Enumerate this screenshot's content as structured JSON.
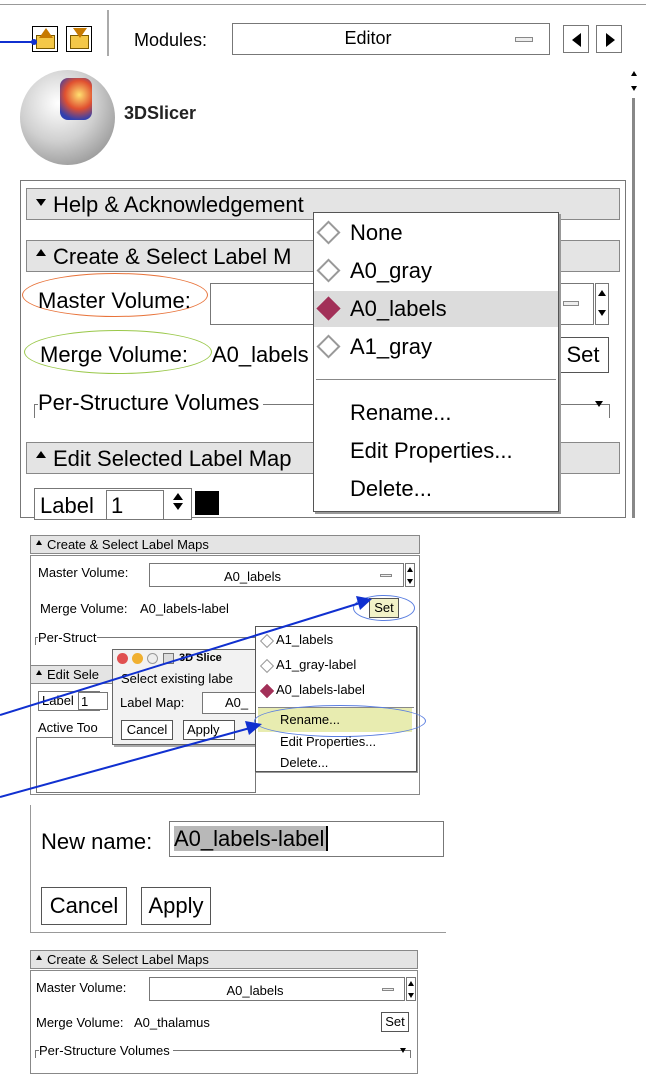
{
  "panel1": {
    "modules_label": "Modules:",
    "module_value": "Editor",
    "logo_text": "3DSlicer",
    "help_header": "Help & Acknowledgement",
    "create_header": "Create & Select Label M",
    "master_label": "Master Volume:",
    "merge_label": "Merge Volume:",
    "merge_value": "A0_labels",
    "set_label": "Set",
    "per_structure": "Per-Structure Volumes",
    "edit_header": "Edit Selected Label Map",
    "label_label": "Label",
    "label_value": "1",
    "menu": {
      "items": [
        "None",
        "A0_gray",
        "A0_labels",
        "A1_gray"
      ],
      "selected": "A0_labels",
      "actions": [
        "Rename...",
        "Edit Properties...",
        "Delete..."
      ]
    }
  },
  "panel2": {
    "create_header": "Create & Select Label Maps",
    "master_label": "Master Volume:",
    "master_value": "A0_labels",
    "merge_label": "Merge Volume:",
    "merge_value": "A0_labels-label",
    "set_label": "Set",
    "per_structure": "Per-Struct",
    "dialog_title": "3D Slice",
    "dialog_text": "Select existing labe",
    "labelmap_label": "Label Map:",
    "labelmap_value": "A0_",
    "cancel_label": "Cancel",
    "apply_label": "Apply",
    "edit_header": "Edit Sele",
    "label_label": "Label",
    "label_value": "1",
    "active_tools": "Active Too",
    "menu": {
      "items": [
        "A1_labels",
        "A1_gray-label",
        "A0_labels-label"
      ],
      "selected": "A0_labels-label",
      "actions": [
        "Rename...",
        "Edit Properties...",
        "Delete..."
      ]
    }
  },
  "panel3": {
    "new_name_label": "New name:",
    "new_name_value": "A0_labels-label",
    "cancel_label": "Cancel",
    "apply_label": "Apply"
  },
  "panel4": {
    "create_header": "Create & Select Label Maps",
    "master_label": "Master Volume:",
    "master_value": "A0_labels",
    "merge_label": "Merge Volume:",
    "merge_value": "A0_thalamus",
    "set_label": "Set",
    "per_structure": "Per-Structure Volumes"
  },
  "colors": {
    "highlight_orange": "#e8733a",
    "highlight_green": "#9ac84a",
    "highlight_blue": "#5a7ee0",
    "arrow_blue": "#1030d0",
    "selected_diamond": "#a23058",
    "rename_highlight": "#e8ecb0"
  }
}
